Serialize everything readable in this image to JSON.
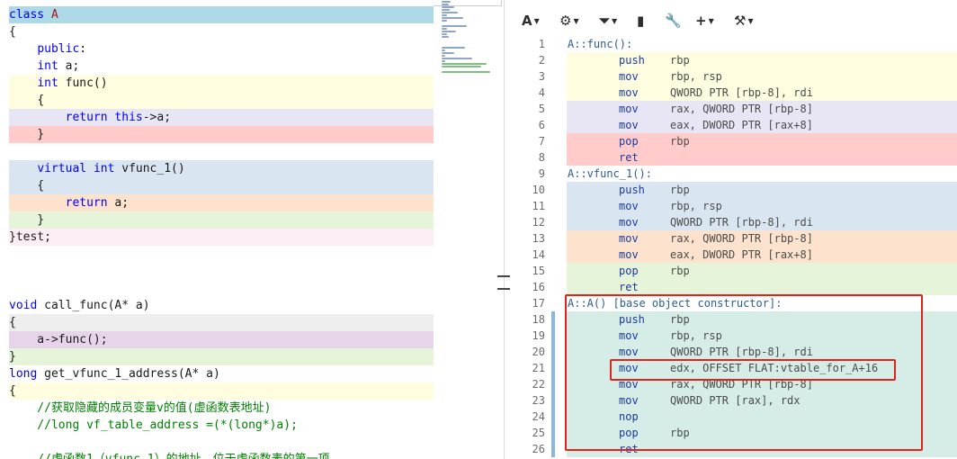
{
  "source": {
    "lines": [
      {
        "text": "class A",
        "bg": "#add8e6",
        "parts": [
          [
            "k",
            "class "
          ],
          [
            "r",
            "A"
          ]
        ]
      },
      {
        "text": "{",
        "bg": "#ffffff",
        "parts": [
          [
            "t",
            "{"
          ]
        ]
      },
      {
        "text": "    public:",
        "bg": "#ffffff",
        "parts": [
          [
            "t",
            "    "
          ],
          [
            "k",
            "public"
          ],
          [
            "t",
            ":"
          ]
        ]
      },
      {
        "text": "    int a;",
        "bg": "#ffffff",
        "parts": [
          [
            "t",
            "    "
          ],
          [
            "k",
            "int"
          ],
          [
            "t",
            " a;"
          ]
        ]
      },
      {
        "text": "    int func()",
        "bg": "#fffde0",
        "parts": [
          [
            "t",
            "    "
          ],
          [
            "k",
            "int"
          ],
          [
            "t",
            " func()"
          ]
        ]
      },
      {
        "text": "    {",
        "bg": "#fffde0",
        "parts": [
          [
            "g",
            "    "
          ],
          [
            "t",
            "{"
          ]
        ]
      },
      {
        "text": "        return this->a;",
        "bg": "#e8e6f4",
        "parts": [
          [
            "t",
            "        "
          ],
          [
            "k",
            "return"
          ],
          [
            "t",
            " "
          ],
          [
            "k",
            "this"
          ],
          [
            "t",
            "->a;"
          ]
        ]
      },
      {
        "text": "    }",
        "bg": "#ffcccb",
        "parts": [
          [
            "t",
            "    }"
          ]
        ]
      },
      {
        "text": "",
        "bg": "#ffffff",
        "parts": []
      },
      {
        "text": "    virtual int vfunc_1()",
        "bg": "#d9e6f2",
        "parts": [
          [
            "t",
            "    "
          ],
          [
            "k",
            "virtual"
          ],
          [
            "t",
            " "
          ],
          [
            "k",
            "int"
          ],
          [
            "t",
            " vfunc_1()"
          ]
        ]
      },
      {
        "text": "    {",
        "bg": "#d9e6f2",
        "parts": [
          [
            "t",
            "    {"
          ]
        ]
      },
      {
        "text": "        return a;",
        "bg": "#fde3cd",
        "parts": [
          [
            "t",
            "        "
          ],
          [
            "k",
            "return"
          ],
          [
            "t",
            " a;"
          ]
        ]
      },
      {
        "text": "    }",
        "bg": "#e6f4d9",
        "parts": [
          [
            "t",
            "    }"
          ]
        ]
      },
      {
        "text": "}test;",
        "bg": "#fdeef6",
        "parts": [
          [
            "t",
            "}test;"
          ]
        ]
      },
      {
        "text": "",
        "bg": "#ffffff",
        "parts": []
      },
      {
        "text": "",
        "bg": "#ffffff",
        "parts": []
      },
      {
        "text": "",
        "bg": "#ffffff",
        "parts": []
      },
      {
        "text": "void call_func(A* a)",
        "bg": "#ffffff",
        "parts": [
          [
            "k",
            "void"
          ],
          [
            "t",
            " call_func(A* a)"
          ]
        ]
      },
      {
        "text": "{",
        "bg": "#eeeeee",
        "parts": [
          [
            "t",
            "{"
          ]
        ]
      },
      {
        "text": "    a->func();",
        "bg": "#e7d3ea",
        "parts": [
          [
            "t",
            "    a->func();"
          ]
        ]
      },
      {
        "text": "}",
        "bg": "#e6f4d9",
        "parts": [
          [
            "t",
            "}"
          ]
        ]
      },
      {
        "text": "long get_vfunc_1_address(A* a)",
        "bg": "#ffffff",
        "parts": [
          [
            "k",
            "long"
          ],
          [
            "t",
            " get_vfunc_1_address(A* a)"
          ]
        ]
      },
      {
        "text": "{",
        "bg": "#fffde0",
        "parts": [
          [
            "t",
            "{"
          ]
        ]
      },
      {
        "text": "    //获取隐藏的成员变量v的值(虚函数表地址)",
        "bg": "#ffffff",
        "parts": [
          [
            "c",
            "    //获取隐藏的成员变量v的值(虚函数表地址)"
          ]
        ]
      },
      {
        "text": "    //long vf_table_address =(*(long*)a);",
        "bg": "#ffffff",
        "parts": [
          [
            "c",
            "    //long vf_table_address =(*(long*)a);"
          ]
        ]
      },
      {
        "text": "",
        "bg": "#ffffff",
        "parts": []
      },
      {
        "text": "    //虚函数1（vfunc_1）的地址，位于虚函数表的第一项",
        "bg": "#ffffff",
        "parts": [
          [
            "c",
            "    //虚函数1（vfunc_1）的地址，位于虚函数表的第一项"
          ]
        ]
      }
    ]
  },
  "toolbar": {
    "font_label": "A",
    "items": [
      {
        "name": "font-size-icon",
        "glyph": "A"
      },
      {
        "name": "settings-gear-icon",
        "glyph": "⚙"
      },
      {
        "name": "filter-icon",
        "glyph": "⏷"
      },
      {
        "name": "book-icon",
        "glyph": "▮"
      },
      {
        "name": "wrench-icon",
        "glyph": "🔧"
      },
      {
        "name": "add-icon",
        "glyph": "+"
      },
      {
        "name": "tools-icon",
        "glyph": "⚒"
      }
    ]
  },
  "asm": {
    "lines": [
      {
        "n": "1",
        "label": "A::func():",
        "bg": "#ffffff"
      },
      {
        "n": "2",
        "op": "push",
        "arg": "rbp",
        "bg": "#fffde0"
      },
      {
        "n": "3",
        "op": "mov",
        "arg": "rbp, rsp",
        "bg": "#fffde0"
      },
      {
        "n": "4",
        "op": "mov",
        "arg": "QWORD PTR [rbp-8], rdi",
        "bg": "#fffde0"
      },
      {
        "n": "5",
        "op": "mov",
        "arg": "rax, QWORD PTR [rbp-8]",
        "bg": "#e8e6f4"
      },
      {
        "n": "6",
        "op": "mov",
        "arg": "eax, DWORD PTR [rax+8]",
        "bg": "#e8e6f4"
      },
      {
        "n": "7",
        "op": "pop",
        "arg": "rbp",
        "bg": "#ffcccb"
      },
      {
        "n": "8",
        "op": "ret",
        "arg": "",
        "bg": "#ffcccb"
      },
      {
        "n": "9",
        "label": "A::vfunc_1():",
        "bg": "#ffffff"
      },
      {
        "n": "10",
        "op": "push",
        "arg": "rbp",
        "bg": "#d9e6f2"
      },
      {
        "n": "11",
        "op": "mov",
        "arg": "rbp, rsp",
        "bg": "#d9e6f2"
      },
      {
        "n": "12",
        "op": "mov",
        "arg": "QWORD PTR [rbp-8], rdi",
        "bg": "#d9e6f2"
      },
      {
        "n": "13",
        "op": "mov",
        "arg": "rax, QWORD PTR [rbp-8]",
        "bg": "#fde3cd"
      },
      {
        "n": "14",
        "op": "mov",
        "arg": "eax, DWORD PTR [rax+8]",
        "bg": "#fde3cd"
      },
      {
        "n": "15",
        "op": "pop",
        "arg": "rbp",
        "bg": "#e6f4d9"
      },
      {
        "n": "16",
        "op": "ret",
        "arg": "",
        "bg": "#e6f4d9"
      },
      {
        "n": "17",
        "label": "A::A() [base object constructor]:",
        "bg": "#ffffff"
      },
      {
        "n": "18",
        "op": "push",
        "arg": "rbp",
        "bg": "#d6ece6"
      },
      {
        "n": "19",
        "op": "mov",
        "arg": "rbp, rsp",
        "bg": "#d6ece6"
      },
      {
        "n": "20",
        "op": "mov",
        "arg": "QWORD PTR [rbp-8], rdi",
        "bg": "#d6ece6"
      },
      {
        "n": "21",
        "op": "mov",
        "arg": "edx, OFFSET FLAT:vtable_for_A+16",
        "bg": "#d6ece6"
      },
      {
        "n": "22",
        "op": "mov",
        "arg": "rax, QWORD PTR [rbp-8]",
        "bg": "#d6ece6"
      },
      {
        "n": "23",
        "op": "mov",
        "arg": "QWORD PTR [rax], rdx",
        "bg": "#d6ece6"
      },
      {
        "n": "24",
        "op": "nop",
        "arg": "",
        "bg": "#d6ece6"
      },
      {
        "n": "25",
        "op": "pop",
        "arg": "rbp",
        "bg": "#d6ece6"
      },
      {
        "n": "26",
        "op": "ret",
        "arg": "",
        "bg": "#d6ece6"
      }
    ]
  },
  "colors": {
    "highlight_box": "#e0241b",
    "gutter_marker": "#5b9bd5"
  }
}
